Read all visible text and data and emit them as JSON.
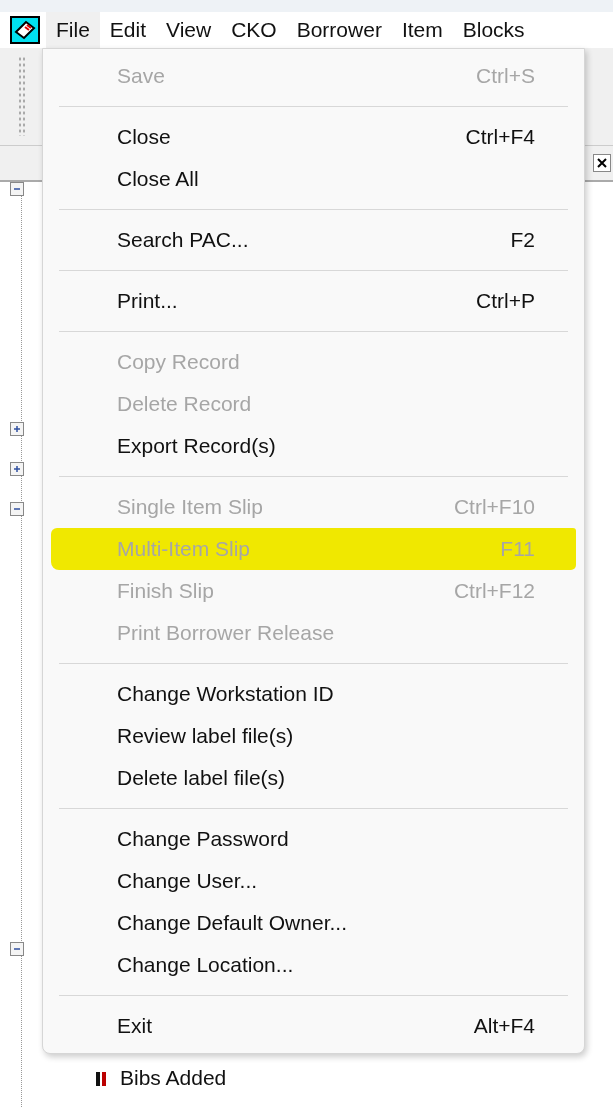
{
  "menu_bar": [
    {
      "label": "File",
      "selected": true
    },
    {
      "label": "Edit",
      "selected": false
    },
    {
      "label": "View",
      "selected": false
    },
    {
      "label": "CKO",
      "selected": false
    },
    {
      "label": "Borrower",
      "selected": false
    },
    {
      "label": "Item",
      "selected": false
    },
    {
      "label": "Blocks",
      "selected": false
    }
  ],
  "tree": {
    "nodes": [
      {
        "expanded": true
      },
      {
        "expanded": false
      },
      {
        "expanded": false
      },
      {
        "expanded": true
      },
      {
        "expanded": true
      }
    ],
    "partial_item": "Bibs Added"
  },
  "file_menu": [
    {
      "kind": "item",
      "label": "Save",
      "shortcut": "Ctrl+S",
      "disabled": true,
      "highlighted": false
    },
    {
      "kind": "separator"
    },
    {
      "kind": "item",
      "label": "Close",
      "shortcut": "Ctrl+F4",
      "disabled": false,
      "highlighted": false
    },
    {
      "kind": "item",
      "label": "Close All",
      "disabled": false,
      "highlighted": false
    },
    {
      "kind": "separator"
    },
    {
      "kind": "item",
      "label": "Search PAC...",
      "shortcut": "F2",
      "disabled": false,
      "highlighted": false
    },
    {
      "kind": "separator"
    },
    {
      "kind": "item",
      "label": "Print...",
      "shortcut": "Ctrl+P",
      "disabled": false,
      "highlighted": false
    },
    {
      "kind": "separator"
    },
    {
      "kind": "item",
      "label": "Copy Record",
      "disabled": true,
      "highlighted": false
    },
    {
      "kind": "item",
      "label": "Delete Record",
      "disabled": true,
      "highlighted": false
    },
    {
      "kind": "item",
      "label": "Export Record(s)",
      "disabled": false,
      "highlighted": false
    },
    {
      "kind": "separator"
    },
    {
      "kind": "item",
      "label": "Single Item Slip",
      "shortcut": "Ctrl+F10",
      "disabled": true,
      "highlighted": false
    },
    {
      "kind": "item",
      "label": "Multi-Item Slip",
      "shortcut": "F11",
      "disabled": true,
      "highlighted": true
    },
    {
      "kind": "item",
      "label": "Finish Slip",
      "shortcut": "Ctrl+F12",
      "disabled": true,
      "highlighted": false
    },
    {
      "kind": "item",
      "label": "Print Borrower Release",
      "disabled": true,
      "highlighted": false
    },
    {
      "kind": "separator"
    },
    {
      "kind": "item",
      "label": "Change Workstation ID",
      "disabled": false,
      "highlighted": false
    },
    {
      "kind": "item",
      "label": "Review label file(s)",
      "disabled": false,
      "highlighted": false
    },
    {
      "kind": "item",
      "label": "Delete label file(s)",
      "disabled": false,
      "highlighted": false
    },
    {
      "kind": "separator"
    },
    {
      "kind": "item",
      "label": "Change Password",
      "disabled": false,
      "highlighted": false
    },
    {
      "kind": "item",
      "label": "Change User...",
      "disabled": false,
      "highlighted": false
    },
    {
      "kind": "item",
      "label": "Change Default Owner...",
      "disabled": false,
      "highlighted": false
    },
    {
      "kind": "item",
      "label": "Change Location...",
      "disabled": false,
      "highlighted": false
    },
    {
      "kind": "separator"
    },
    {
      "kind": "item",
      "label": "Exit",
      "shortcut": "Alt+F4",
      "disabled": false,
      "highlighted": false
    }
  ]
}
